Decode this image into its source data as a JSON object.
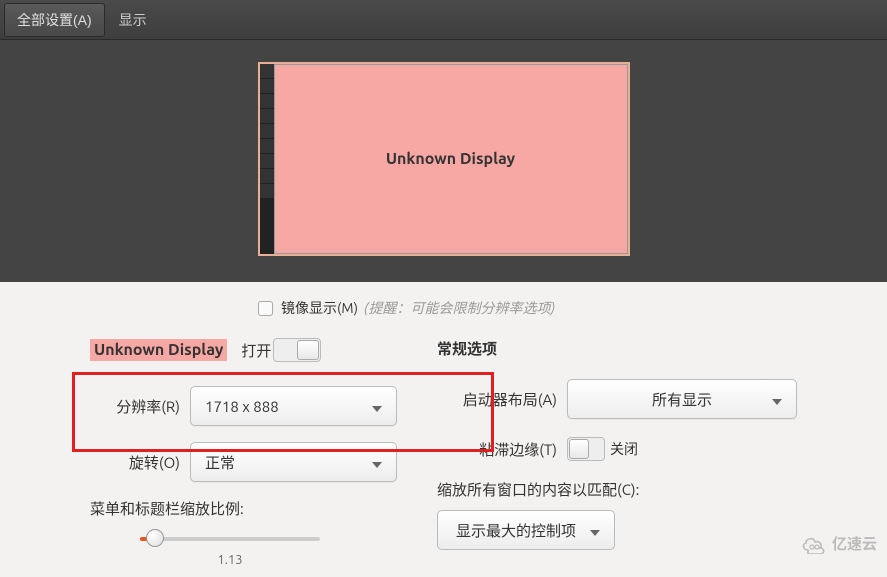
{
  "toolbar": {
    "all_settings": "全部设置(A)",
    "current": "显示"
  },
  "preview": {
    "display_name": "Unknown Display"
  },
  "mirror": {
    "label": "镜像显示(M)",
    "note": "(提醒：可能会限制分辨率选项)"
  },
  "left": {
    "display_name": "Unknown Display",
    "open_label": "打开",
    "resolution_label": "分辨率(R)",
    "resolution_value": "1718 x 888",
    "rotation_label": "旋转(O)",
    "rotation_value": "正常",
    "scale_label": "菜单和标题栏缩放比例:",
    "scale_value": "1.13"
  },
  "right": {
    "section_title": "常规选项",
    "launcher_label": "启动器布局(A)",
    "launcher_value": "所有显示",
    "sticky_label": "粘滞边缘(T)",
    "sticky_value": "关闭",
    "scale_windows_label": "缩放所有窗口的内容以匹配(C):",
    "max_button": "显示最大的控制项"
  },
  "watermark": "亿速云"
}
